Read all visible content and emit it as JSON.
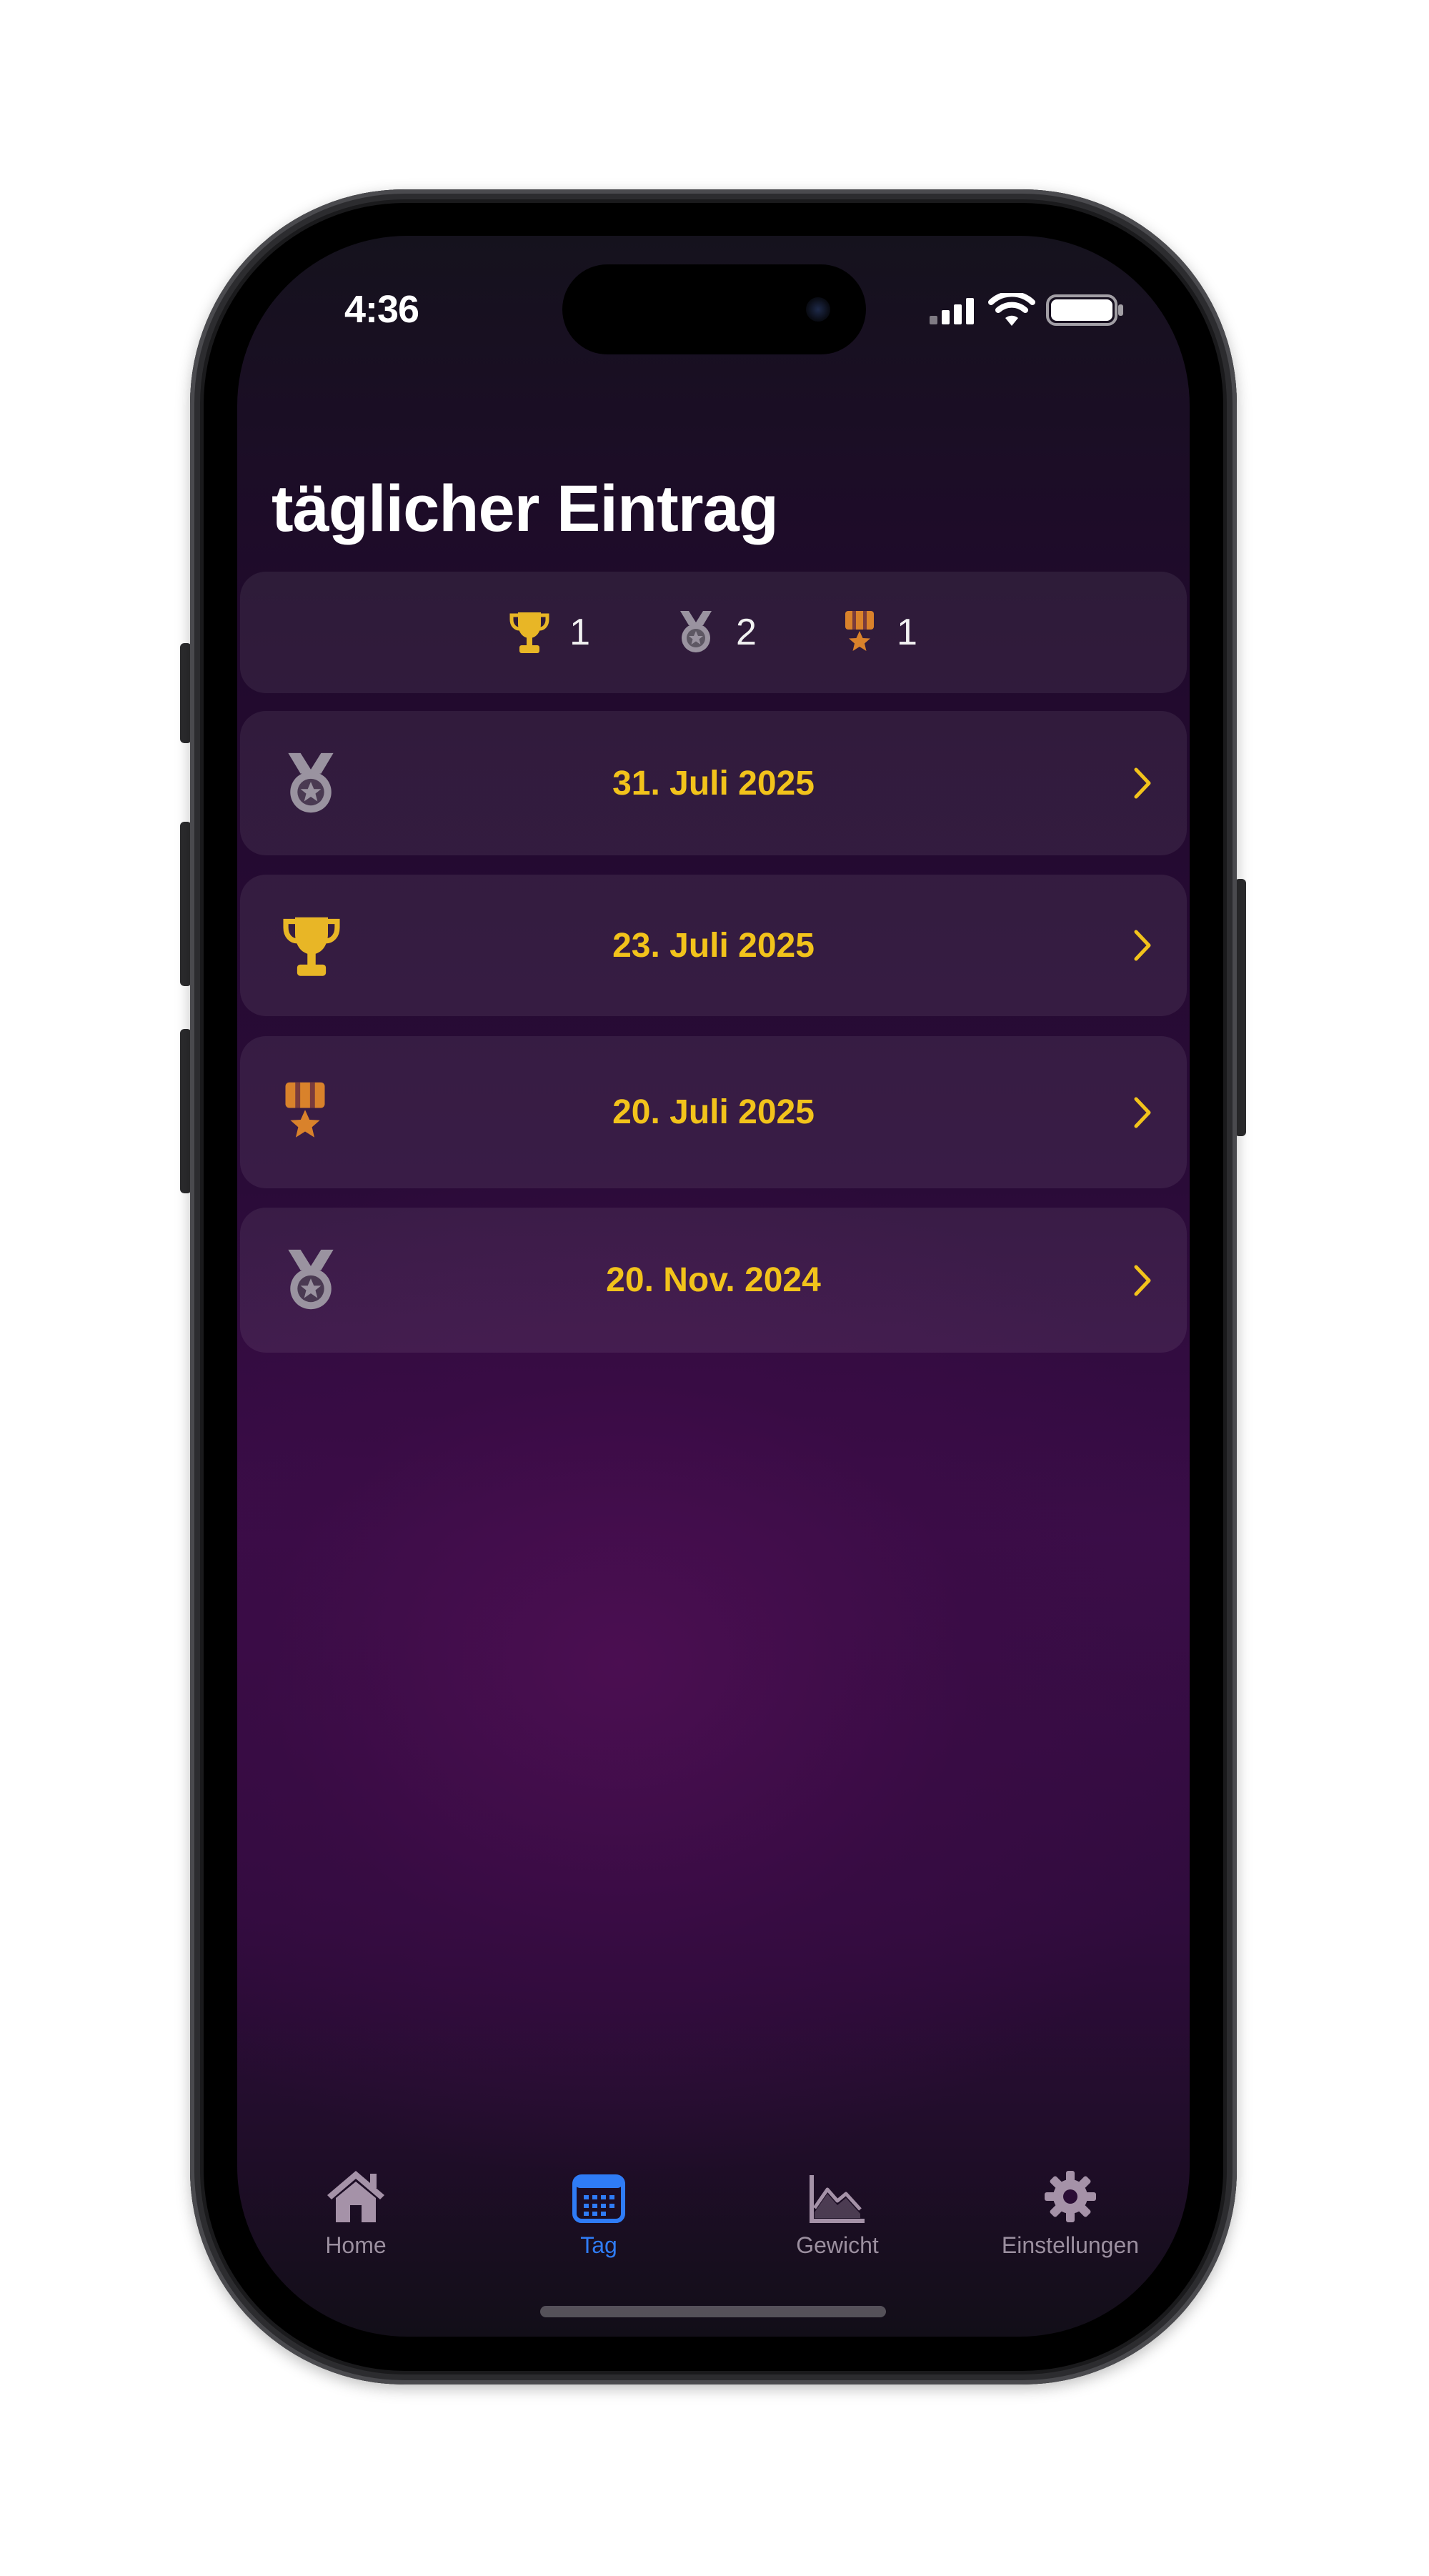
{
  "status_bar": {
    "time": "4:36"
  },
  "page": {
    "title": "täglicher Eintrag"
  },
  "summary": {
    "items": [
      {
        "icon": "trophy-icon",
        "count": "1"
      },
      {
        "icon": "silver-medal-icon",
        "count": "2"
      },
      {
        "icon": "bronze-medal-icon",
        "count": "1"
      }
    ]
  },
  "entries": [
    {
      "date": "31. Juli 2025",
      "icon": "silver-medal-icon"
    },
    {
      "date": "23. Juli 2025",
      "icon": "trophy-icon"
    },
    {
      "date": "20. Juli 2025",
      "icon": "bronze-medal-icon"
    },
    {
      "date": "20. Nov. 2024",
      "icon": "silver-medal-icon"
    }
  ],
  "tabbar": {
    "items": [
      {
        "label": "Home",
        "icon": "house-icon",
        "active": false
      },
      {
        "label": "Tag",
        "icon": "calendar-icon",
        "active": true
      },
      {
        "label": "Gewicht",
        "icon": "chart-icon",
        "active": false
      },
      {
        "label": "Einstellungen",
        "icon": "gear-icon",
        "active": false
      }
    ]
  },
  "colors": {
    "accent_date": "#f2c31b",
    "tab_active": "#2f7cf6",
    "tab_inactive": "#9b8f9f",
    "gold": "#e8b626",
    "silver": "#9a93a0",
    "bronze": "#d9822b"
  }
}
